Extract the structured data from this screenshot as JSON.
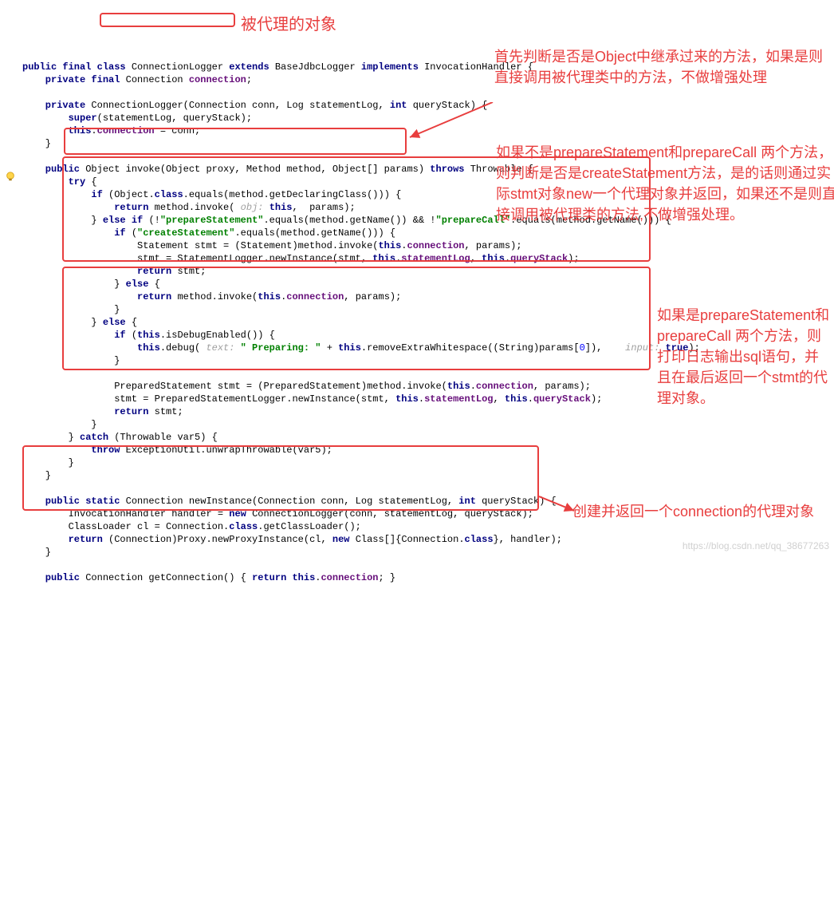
{
  "code": {
    "l1_pre": "public final class ",
    "l1_cls": "ConnectionLogger ",
    "l1_mid": "extends ",
    "l1_base": "BaseJdbcLogger ",
    "l1_impl": "implements ",
    "l1_intf": "InvocationHandler {",
    "l2a": "    private final ",
    "l2b": "Connection ",
    "l2c": "connection",
    "l4a": "    private ",
    "l4b": "ConnectionLogger(Connection conn, Log statementLog, ",
    "l4c": "int ",
    "l4d": "queryStack) {",
    "l5a": "        super",
    "l5b": "(statementLog, queryStack);",
    "l6a": "        this",
    "l6b": ".",
    "l6c": "connection ",
    "l6d": "= conn;",
    "l7": "    }",
    "l9a": "    public ",
    "l9b": "Object invoke(Object proxy, Method method, Object[] params) ",
    "l9c": "throws ",
    "l9d": "Throwable {",
    "l10a": "        try ",
    "l10b": "{",
    "l11a": "            if ",
    "l11b": "(Object.",
    "l11c": "class",
    "l11d": ".equals(method.getDeclaringClass())) {",
    "l12a": "                return ",
    "l12b": "method.invoke( ",
    "l12hint": "obj: ",
    "l12c": "this",
    "l12d": ",  params);",
    "l13a": "            } ",
    "l13b": "else if ",
    "l13c": "(!",
    "l13d": "\"prepareStatement\"",
    "l13e": ".equals(method.getName()) && !",
    "l13f": "\"prepareCall\"",
    "l13g": ".equals(method.getName())) {",
    "l14a": "                if ",
    "l14b": "(",
    "l14c": "\"createStatement\"",
    "l14d": ".equals(method.getName())) {",
    "l15a": "                    Statement stmt = (Statement)method.invoke(",
    "l15b": "this",
    "l15c": ".",
    "l15d": "connection",
    "l15e": ", params);",
    "l16a": "                    stmt = StatementLogger.newInstance(stmt, ",
    "l16b": "this",
    "l16c": ".",
    "l16d": "statementLog",
    "l16e": ", ",
    "l16f": "this",
    "l16g": ".",
    "l16h": "queryStack",
    "l16i": ");",
    "l17a": "                    return ",
    "l17b": "stmt;",
    "l18a": "                } ",
    "l18b": "else ",
    "l18c": "{",
    "l19a": "                    return ",
    "l19b": "method.invoke(",
    "l19c": "this",
    "l19d": ".",
    "l19e": "connection",
    "l19f": ", params);",
    "l20": "                }",
    "l21a": "            } ",
    "l21b": "else ",
    "l21c": "{",
    "l22a": "                if ",
    "l22b": "(",
    "l22c": "this",
    "l22d": ".isDebugEnabled()) {",
    "l23a": "                    this",
    "l23b": ".debug( ",
    "l23hint1": "text: ",
    "l23c": "\" Preparing: \" ",
    "l23d": "+ ",
    "l23e": "this",
    "l23f": ".removeExtraWhitespace((String)params[",
    "l23g": "0",
    "l23h": "]), ",
    "l23hint2": "   input: ",
    "l23i": "true",
    "l23j": ");",
    "l24": "                }",
    "l26a": "                PreparedStatement stmt = (PreparedStatement)method.invoke(",
    "l26b": "this",
    "l26c": ".",
    "l26d": "connection",
    "l26e": ", params);",
    "l27a": "                stmt = PreparedStatementLogger.newInstance(stmt, ",
    "l27b": "this",
    "l27c": ".",
    "l27d": "statementLog",
    "l27e": ", ",
    "l27f": "this",
    "l27g": ".",
    "l27h": "queryStack",
    "l27i": ");",
    "l28a": "                return ",
    "l28b": "stmt;",
    "l29": "            }",
    "l30a": "        } ",
    "l30b": "catch ",
    "l30c": "(Throwable var5) {",
    "l31a": "            throw ",
    "l31b": "ExceptionUtil.unwrapThrowable(var5);",
    "l32": "        }",
    "l33": "    }",
    "l35a": "    public static ",
    "l35b": "Connection newInstance(Connection conn, Log statementLog, ",
    "l35c": "int ",
    "l35d": "queryStack) {",
    "l36a": "        InvocationHandler handler = ",
    "l36b": "new ",
    "l36c": "ConnectionLogger(conn, statementLog, queryStack);",
    "l37a": "        ClassLoader cl = Connection.",
    "l37b": "class",
    "l37c": ".getClassLoader();",
    "l38a": "        return ",
    "l38b": "(Connection)Proxy.newProxyInstance(cl, ",
    "l38c": "new ",
    "l38d": "Class[]{Connection.",
    "l38e": "class",
    "l38f": "}, handler);",
    "l39": "    }",
    "l41a": "    public ",
    "l41b": "Connection getConnection() { ",
    "l41c": "return this",
    "l41d": ".",
    "l41e": "connection",
    "l41f": "; }"
  },
  "annotations": {
    "a1": "被代理的对象",
    "a2": "首先判断是否是Object中继承过来的方法，如果是则直接调用被代理类中的方法，不做增强处理",
    "a3": "如果不是prepareStatement和prepareCall 两个方法，则判断是否是createStatement方法，是的话则通过实际stmt对象new一个代理对象并返回，如果还不是则直接调用被代理类的方法,不做增强处理。",
    "a4": "如果是prepareStatement和prepareCall 两个方法，则打印日志输出sql语句，并且在最后返回一个stmt的代理对象。",
    "a5": "创建并返回一个connection的代理对象"
  },
  "watermark": "https://blog.csdn.net/qq_38677263"
}
